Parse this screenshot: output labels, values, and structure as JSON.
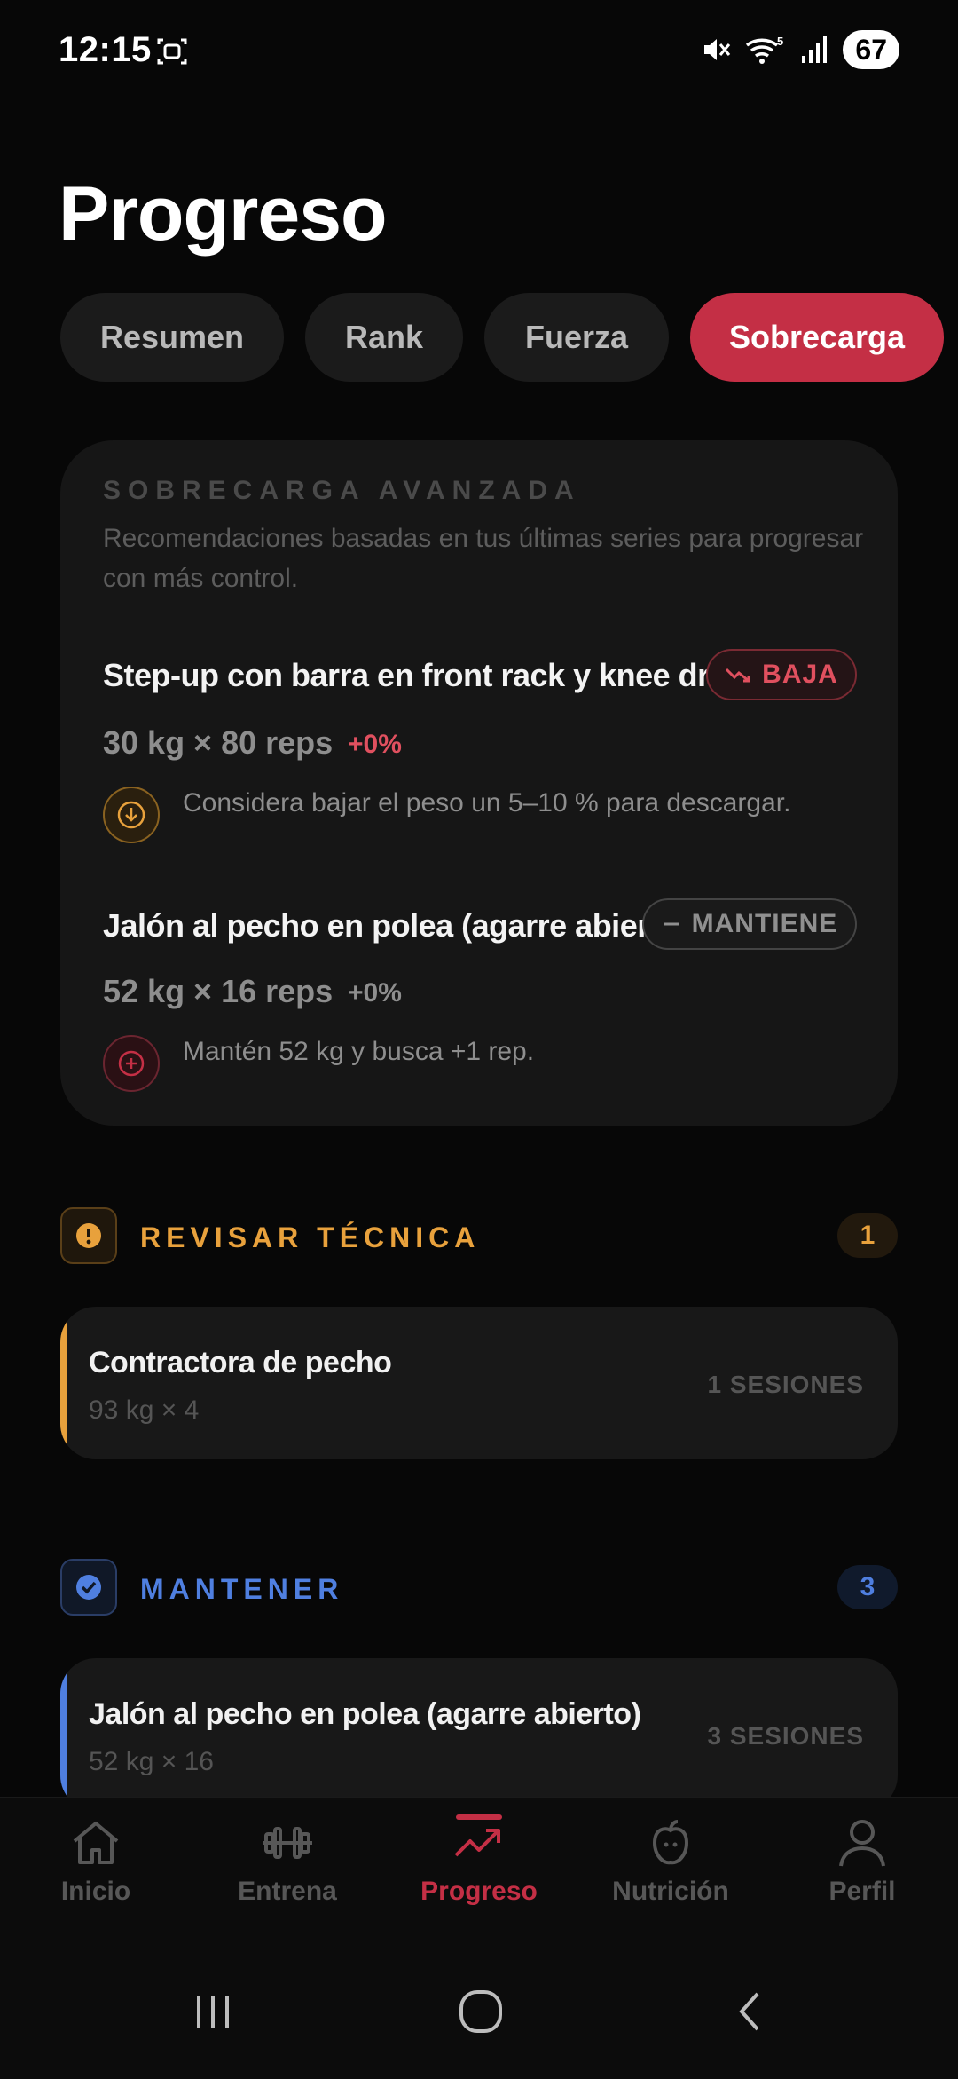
{
  "status": {
    "time": "12:15",
    "battery": "67",
    "network": "5"
  },
  "page": {
    "title": "Progreso"
  },
  "tabs": [
    {
      "label": "Resumen"
    },
    {
      "label": "Rank"
    },
    {
      "label": "Fuerza"
    },
    {
      "label": "Sobrecarga",
      "active": true
    }
  ],
  "overload": {
    "eyebrow": "SOBRECARGA AVANZADA",
    "description": "Recomendaciones basadas en tus últimas series para progresar con más control.",
    "items": [
      {
        "title": "Step-up con barra en front rack y knee drive",
        "badge": "BAJA",
        "badge_icon": "trending-down-icon",
        "weight": "30 kg × 80 reps",
        "delta": "+0%",
        "tip": "Considera bajar el peso un 5–10 % para descargar.",
        "tip_icon": "arrow-down-circle-icon"
      },
      {
        "title": "Jalón al pecho en polea (agarre abierto)",
        "badge": "MANTIENE",
        "badge_icon": "minus-icon",
        "weight": "52 kg × 16 reps",
        "delta": "+0%",
        "tip": "Mantén 52 kg y busca +1 rep.",
        "tip_icon": "plus-circle-icon"
      }
    ]
  },
  "sections": {
    "review": {
      "title": "REVISAR TÉCNICA",
      "count": "1",
      "color": "#e8a13c",
      "rows": [
        {
          "name": "Contractora de pecho",
          "detail": "93 kg × 4",
          "sessions": "1 SESIONES"
        }
      ]
    },
    "maintain": {
      "title": "MANTENER",
      "count": "3",
      "color": "#4f7fe0",
      "rows": [
        {
          "name": "Jalón al pecho en polea (agarre abierto)",
          "detail": "52 kg × 16",
          "sessions": "3 SESIONES"
        }
      ]
    }
  },
  "nav": [
    {
      "label": "Inicio",
      "icon": "home-icon"
    },
    {
      "label": "Entrena",
      "icon": "dumbbell-icon"
    },
    {
      "label": "Progreso",
      "icon": "trending-up-icon",
      "active": true
    },
    {
      "label": "Nutrición",
      "icon": "apple-icon"
    },
    {
      "label": "Perfil",
      "icon": "user-icon"
    }
  ],
  "colors": {
    "accent": "#c42f45",
    "background": "#070707",
    "card": "#161616"
  }
}
